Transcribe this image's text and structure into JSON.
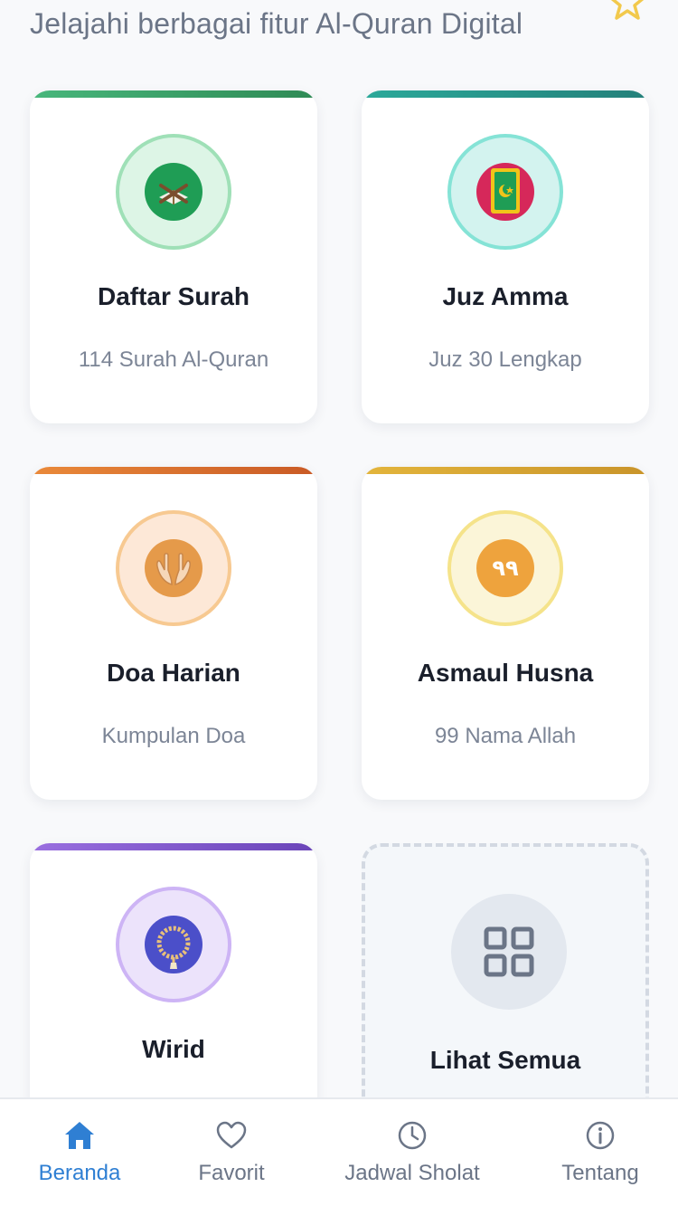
{
  "header": {
    "subtitle": "Jelajahi berbagai fitur Al-Quran Digital"
  },
  "features": [
    {
      "title": "Daftar Surah",
      "description": "114 Surah Al-Quran",
      "icon": "quran-book-icon",
      "accent": "#3aa76d"
    },
    {
      "title": "Juz Amma",
      "description": "Juz 30 Lengkap",
      "icon": "mushaf-icon",
      "accent": "#2a9d8f"
    },
    {
      "title": "Doa Harian",
      "description": "Kumpulan Doa",
      "icon": "praying-hands-icon",
      "accent": "#e07a2f"
    },
    {
      "title": "Asmaul Husna",
      "description": "99 Nama Allah",
      "icon": "number-99-icon",
      "accent": "#d9a52b"
    },
    {
      "title": "Wirid",
      "description": "",
      "icon": "prayer-beads-icon",
      "accent": "#7e57c2"
    },
    {
      "title": "Lihat Semua",
      "icon": "grid-icon"
    }
  ],
  "asmaul_husna_glyph": "٩٩",
  "nav": {
    "items": [
      {
        "label": "Beranda",
        "icon": "home-icon",
        "active": true
      },
      {
        "label": "Favorit",
        "icon": "heart-icon",
        "active": false
      },
      {
        "label": "Jadwal Sholat",
        "icon": "clock-icon",
        "active": false
      },
      {
        "label": "Tentang",
        "icon": "info-icon",
        "active": false
      }
    ]
  },
  "colors": {
    "nav_active": "#2f7fd3",
    "nav_inactive": "#6b7587",
    "star": "#f2c94c"
  }
}
